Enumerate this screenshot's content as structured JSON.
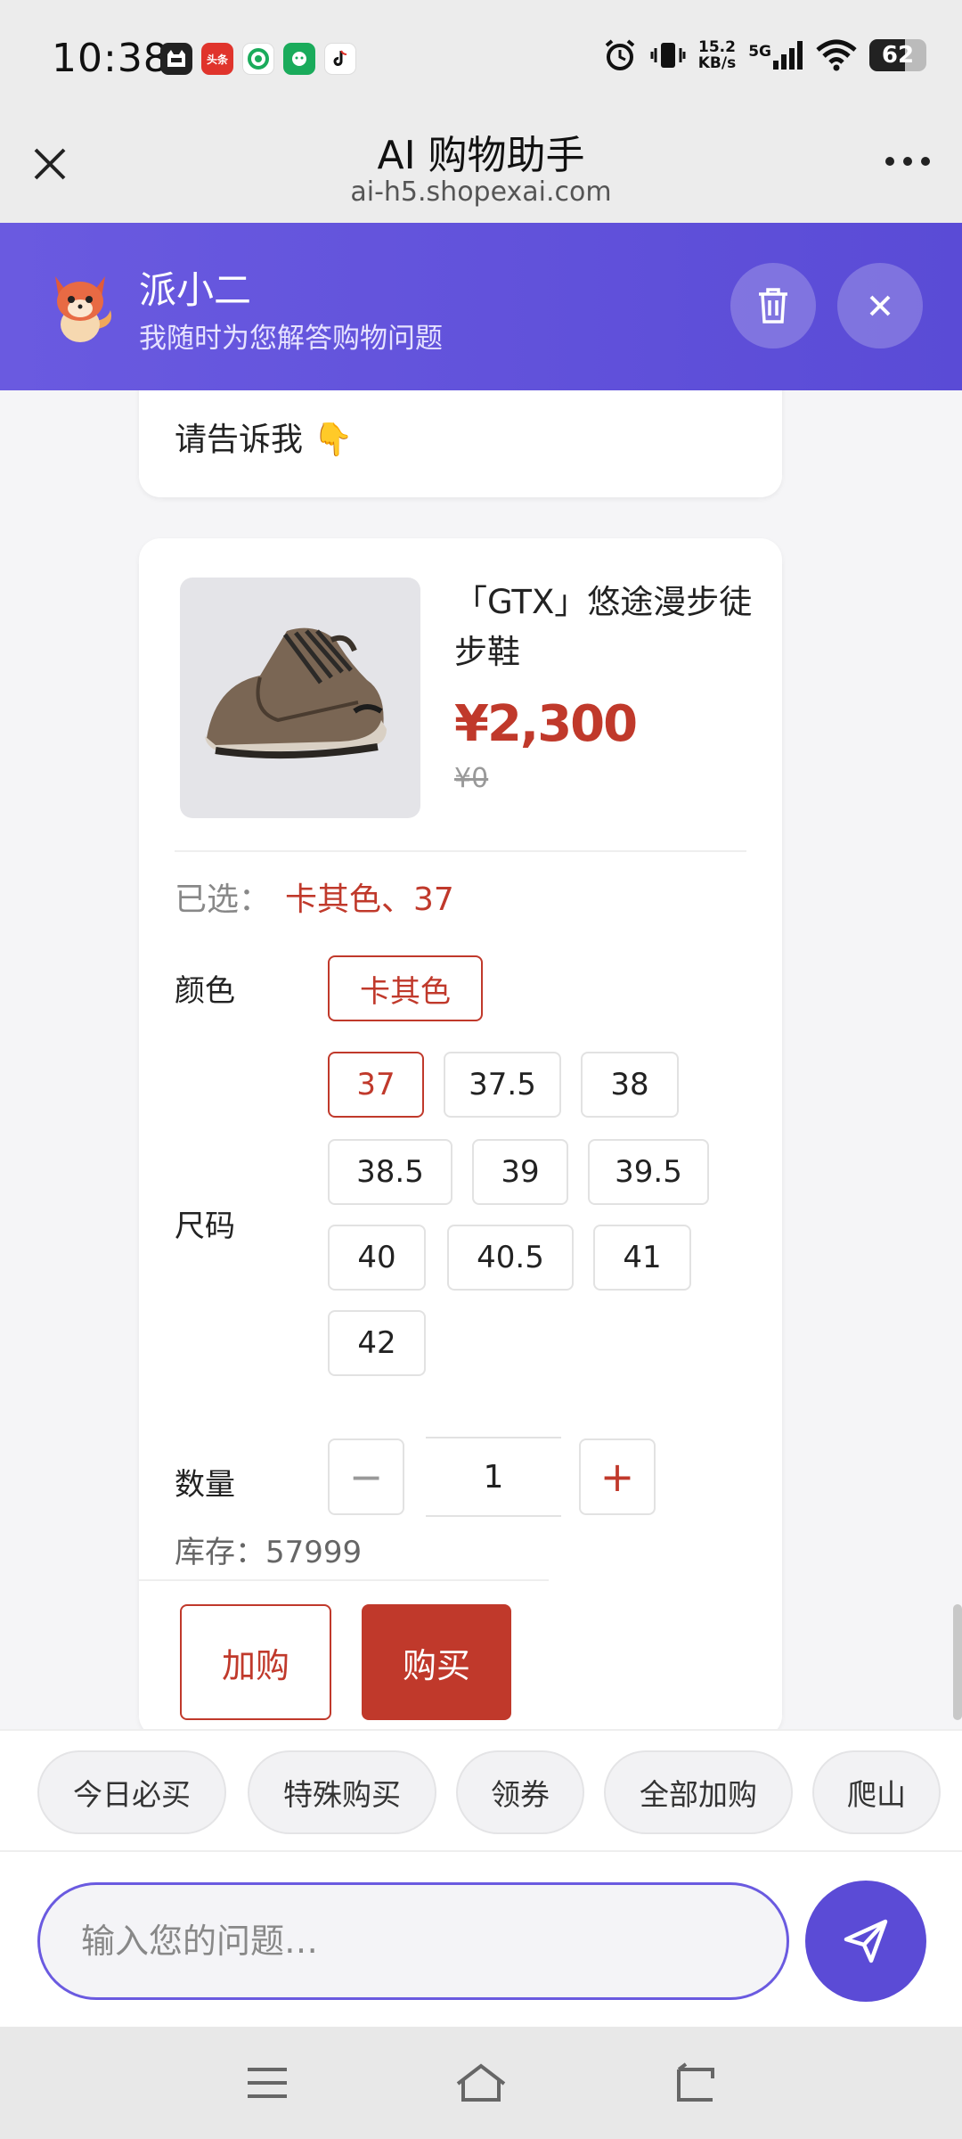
{
  "status_bar": {
    "time": "10:38",
    "net_speed": "15.2",
    "net_speed_unit": "KB/s",
    "network": "5G",
    "battery": 62,
    "apps": [
      "app-mascot",
      "头条",
      "app-green",
      "app-wechat-green",
      "app-tiktok"
    ]
  },
  "nav": {
    "title": "AI 购物助手",
    "url": "ai-h5.shopexai.com"
  },
  "assistant": {
    "name": "派小二",
    "subtitle": "我随时为您解答购物问题",
    "header_color": "#6a5ae0"
  },
  "chat": {
    "bubble_text": "请告诉我 👇",
    "product": {
      "name": "「GTX」悠途漫步徒步鞋",
      "price": "¥2,300",
      "original_price": "¥0",
      "selected_label": "已选：",
      "selected_value": "卡其色、37",
      "color_label": "颜色",
      "colors": [
        "卡其色"
      ],
      "selected_color": "卡其色",
      "size_label": "尺码",
      "sizes": [
        "37",
        "37.5",
        "38",
        "38.5",
        "39",
        "39.5",
        "40",
        "40.5",
        "41",
        "42"
      ],
      "selected_size": "37",
      "qty_label": "数量",
      "qty_minus": "−",
      "qty_plus": "+",
      "quantity": "1",
      "stock": "库存：57999",
      "add_cart_label": "加购",
      "buy_label": "购买",
      "accent_color": "#c0392b"
    }
  },
  "quick_chips": [
    "今日必买",
    "特殊购买",
    "领券",
    "全部加购",
    "爬山"
  ],
  "input": {
    "placeholder": "输入您的问题…"
  }
}
